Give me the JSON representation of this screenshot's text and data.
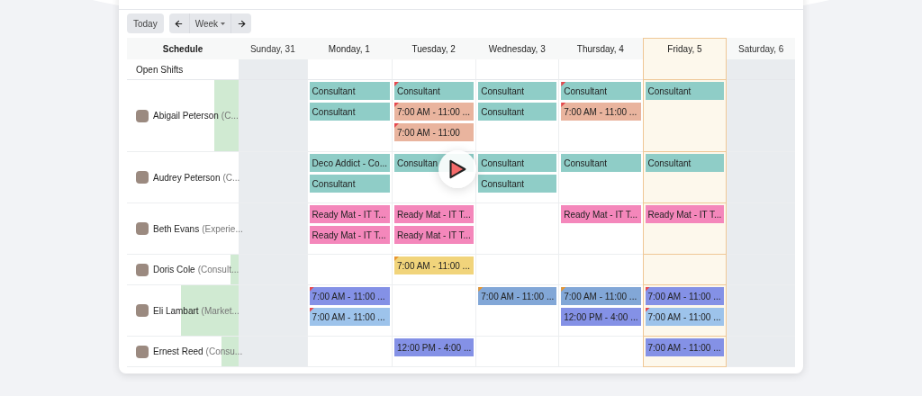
{
  "toolbar": {
    "today": "Today",
    "view": "Week"
  },
  "columns": [
    {
      "label": "Schedule",
      "weekend": false,
      "selected": false
    },
    {
      "label": "Sunday, 31",
      "weekend": true,
      "selected": false
    },
    {
      "label": "Monday, 1",
      "weekend": false,
      "selected": false
    },
    {
      "label": "Tuesday, 2",
      "weekend": false,
      "selected": false
    },
    {
      "label": "Wednesday, 3",
      "weekend": false,
      "selected": false
    },
    {
      "label": "Thursday, 4",
      "weekend": false,
      "selected": false
    },
    {
      "label": "Friday, 5",
      "weekend": false,
      "selected": true
    },
    {
      "label": "Saturday, 6",
      "weekend": true,
      "selected": false
    }
  ],
  "open_shifts": "Open Shifts",
  "rows": [
    {
      "name": "Abigail Peterson",
      "role": "(C...",
      "level": 0.22,
      "shifts": {
        "monday": [
          {
            "text": "Consultant",
            "color": "#8fcdc7"
          },
          {
            "text": "Consultant",
            "color": "#8fcdc7"
          }
        ],
        "tuesday": [
          {
            "text": "Consultant",
            "color": "#8fcdc7",
            "corner_flag": {
              "color": "#e5484d"
            }
          },
          {
            "text": "7:00 AM - 11:00 ...",
            "color": "#e9b49e",
            "corner_flag": {
              "color": "#e5484d"
            }
          },
          {
            "text": "7:00 AM - 11:00",
            "color": "#e9b49e",
            "corner_flag": {
              "color": "#e5484d"
            }
          }
        ],
        "wednesday": [
          {
            "text": "Consultant",
            "color": "#8fcdc7"
          },
          {
            "text": "Consultant",
            "color": "#8fcdc7"
          }
        ],
        "thursday": [
          {
            "text": "Consultant",
            "color": "#8fcdc7",
            "corner_flag": {
              "color": "#e5484d"
            }
          },
          {
            "text": "7:00 AM - 11:00 ...",
            "color": "#e9b49e",
            "corner_flag": {
              "color": "#e5484d"
            }
          }
        ],
        "friday": [
          {
            "text": "Consultant",
            "color": "#8fcdc7"
          }
        ]
      }
    },
    {
      "name": "Audrey Peterson",
      "role": "(C...",
      "shifts": {
        "monday": [
          {
            "text": "Deco Addict - Co...",
            "color": "#8fcdc7"
          },
          {
            "text": "Consultant",
            "color": "#8fcdc7"
          }
        ],
        "tuesday": [
          {
            "text": "Consultan",
            "color": "#8fcdc7"
          }
        ],
        "wednesday": [
          {
            "text": "Consultant",
            "color": "#8fcdc7"
          },
          {
            "text": "Consultant",
            "color": "#8fcdc7"
          }
        ],
        "thursday": [
          {
            "text": "Consultant",
            "color": "#8fcdc7"
          }
        ],
        "friday": [
          {
            "text": "Consultant",
            "color": "#8fcdc7"
          }
        ]
      }
    },
    {
      "name": "Beth Evans",
      "role": "(Experie...",
      "shifts": {
        "monday": [
          {
            "text": "Ready Mat - IT T...",
            "color": "#f487bb"
          },
          {
            "text": "Ready Mat - IT T...",
            "color": "#f487bb"
          }
        ],
        "tuesday": [
          {
            "text": "Ready Mat - IT T...",
            "color": "#f487bb"
          },
          {
            "text": "Ready Mat - IT T...",
            "color": "#f487bb"
          }
        ],
        "thursday": [
          {
            "text": "Ready Mat - IT T...",
            "color": "#f487bb"
          }
        ],
        "friday": [
          {
            "text": "Ready Mat - IT T...",
            "color": "#f487bb"
          }
        ]
      }
    },
    {
      "name": "Doris Cole",
      "role": "(Consult...",
      "level": 0.07,
      "shifts": {
        "tuesday": [
          {
            "text": "7:00 AM - 11:00 ...",
            "color": "#f1d47b",
            "corner_flag": {
              "color": "#e8962e"
            }
          }
        ]
      }
    },
    {
      "name": "Eli Lambart",
      "role": "(Market...",
      "level": 0.52,
      "shifts": {
        "monday": [
          {
            "text": "7:00 AM - 11:00 ...",
            "color": "#8491e6",
            "corner_flag": {
              "color": "#e5484d"
            }
          },
          {
            "text": "7:00 AM - 11:00 ...",
            "color": "#9dc3eb",
            "corner_flag": {
              "color": "#e5484d"
            }
          }
        ],
        "wednesday": [
          {
            "text": "7:00 AM - 11:00 ...",
            "color": "#82a7d7",
            "corner_flag": {
              "color": "#e8962e"
            }
          }
        ],
        "thursday": [
          {
            "text": "7:00 AM - 11:00 ...",
            "color": "#82a7d7",
            "corner_flag": {
              "color": "#e8962e"
            }
          },
          {
            "text": "12:00 PM - 4:00 ...",
            "color": "#8491e6"
          }
        ],
        "friday": [
          {
            "text": "7:00 AM - 11:00 ...",
            "color": "#8491e6",
            "corner_flag": {
              "color": "#e5484d"
            }
          },
          {
            "text": "7:00 AM - 11:00 ...",
            "color": "#9dc3eb",
            "corner_flag": {
              "color": "#e5484d"
            }
          }
        ]
      }
    },
    {
      "name": "Ernest Reed",
      "role": "(Consu...",
      "level": 0.15,
      "shifts": {
        "tuesday": [
          {
            "text": "12:00 PM - 4:00 ...",
            "color": "#8491e6"
          }
        ],
        "friday": [
          {
            "text": "7:00 AM - 11:00 ...",
            "color": "#8491e6"
          }
        ]
      }
    }
  ]
}
